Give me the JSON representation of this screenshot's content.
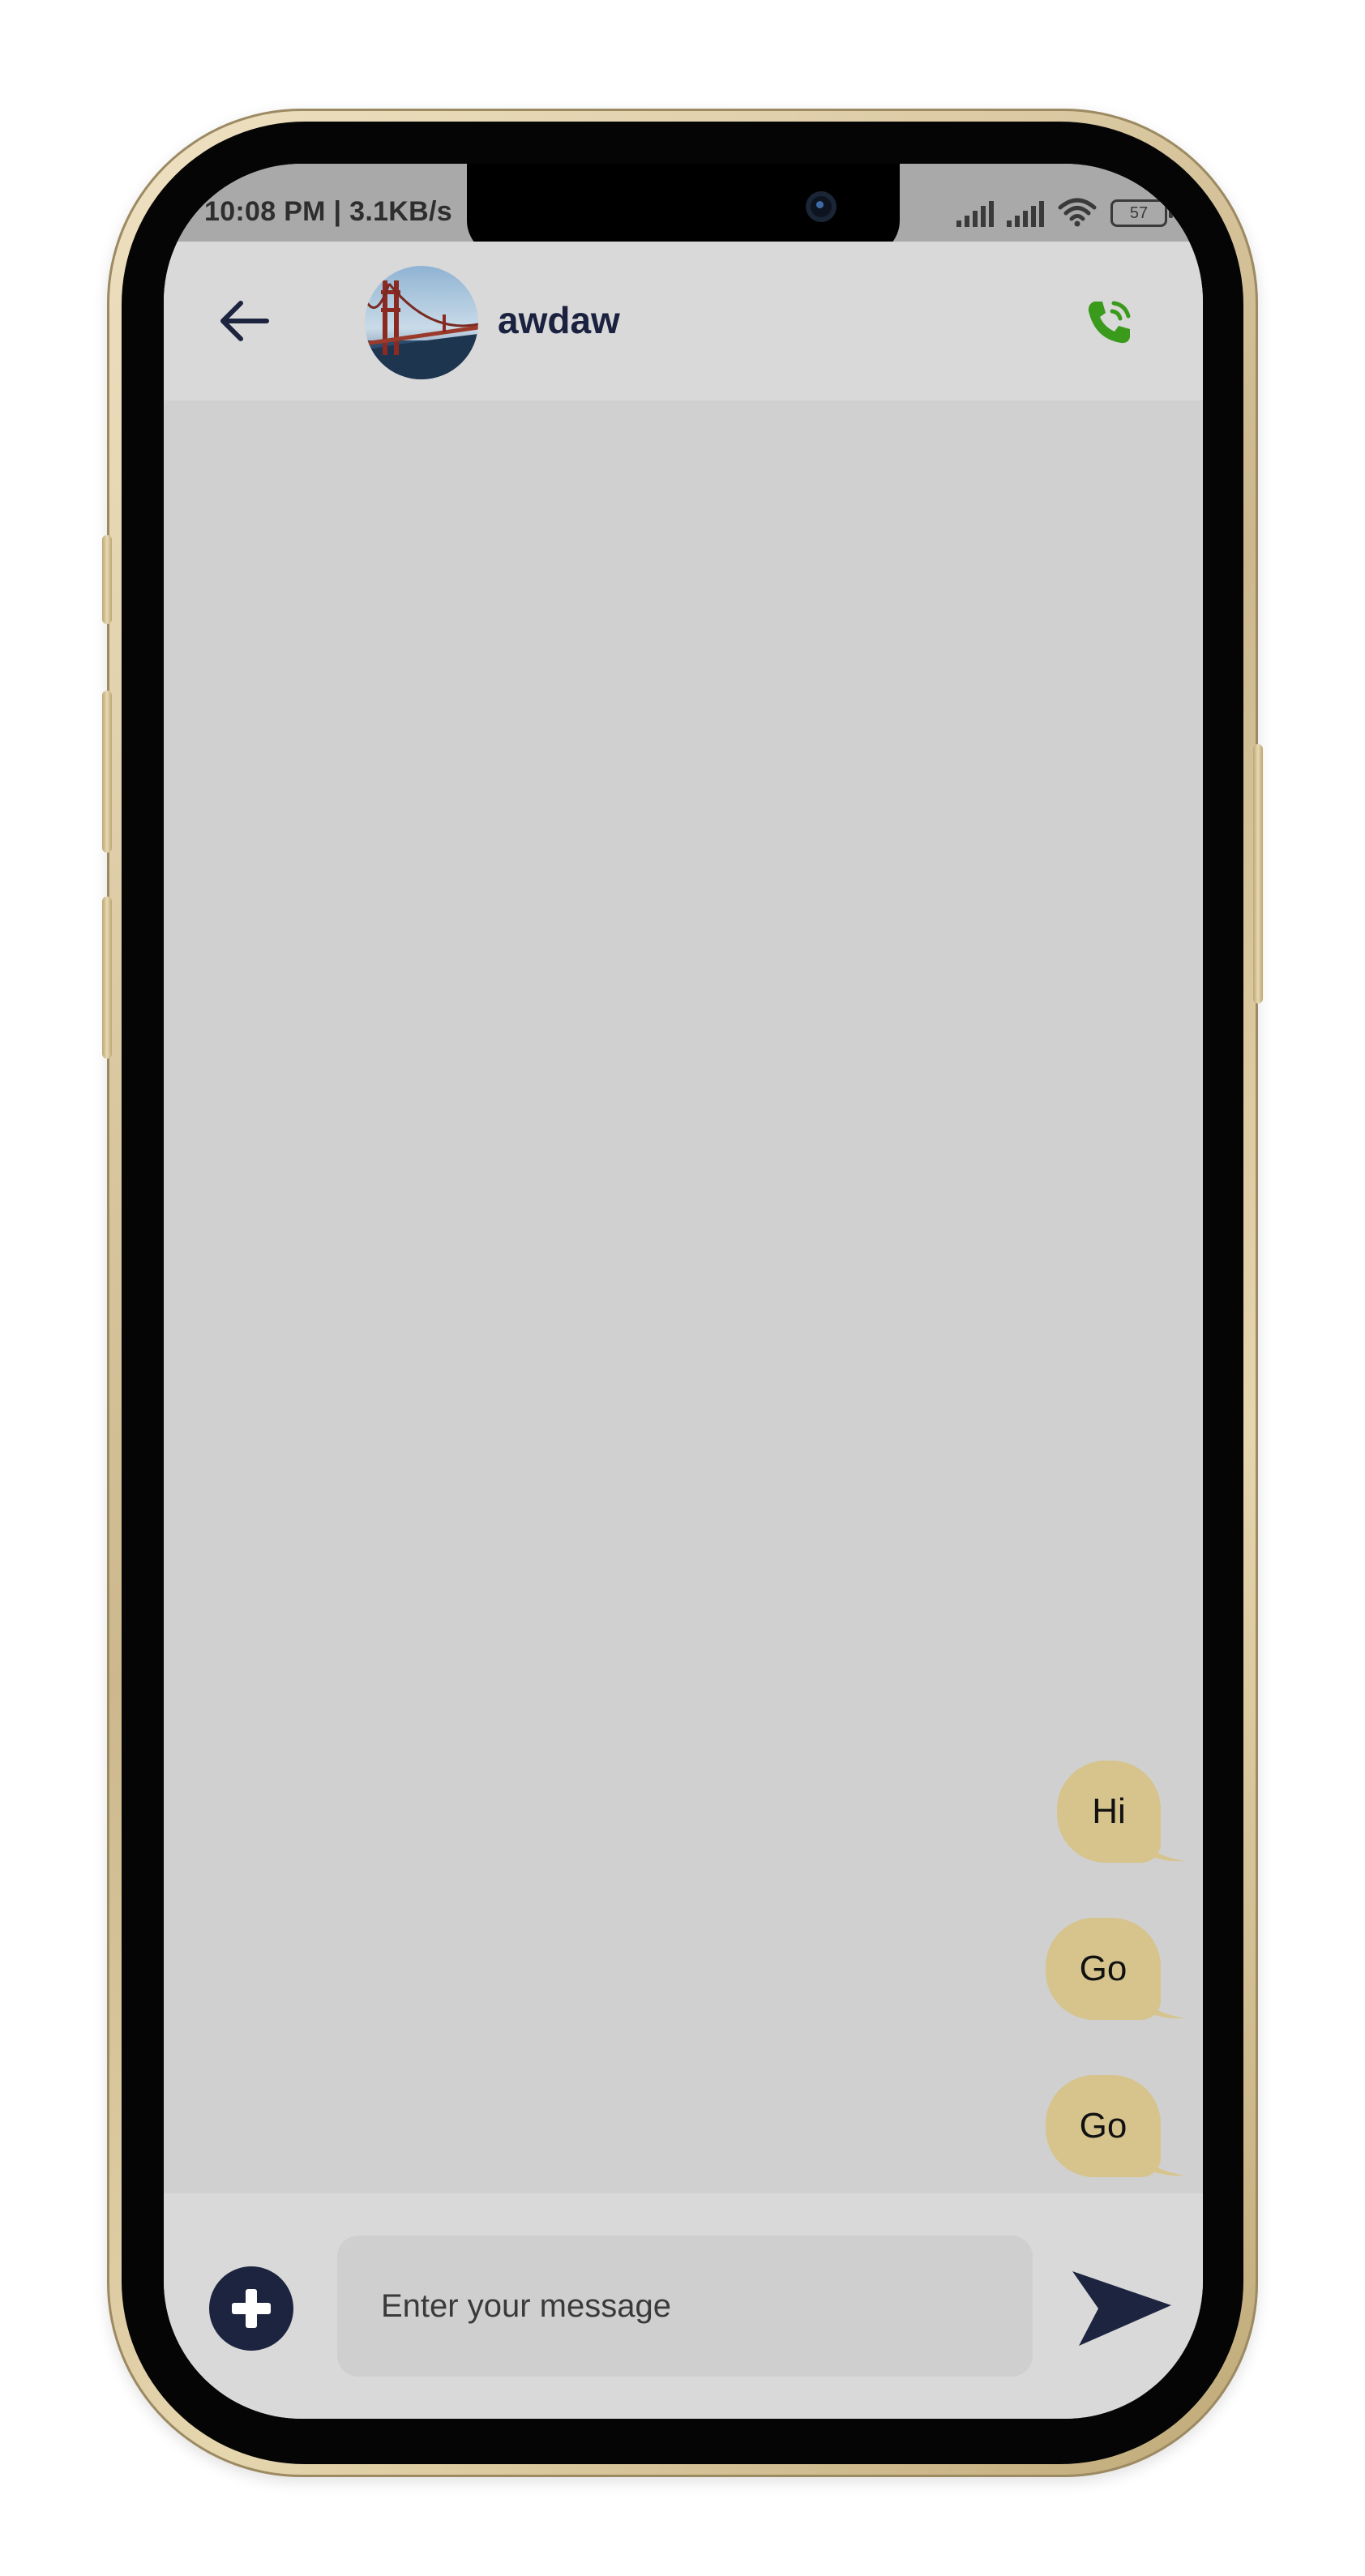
{
  "status_bar": {
    "time": "10:08 PM | 3.1KB/s",
    "battery_level": "57"
  },
  "header": {
    "back_icon": "arrow-left-icon",
    "avatar_icon": "golden-gate-bridge-photo",
    "contact_name": "awdaw",
    "call_icon": "phone-call-icon",
    "call_color": "#3a9a1c"
  },
  "messages": [
    {
      "text": "Hi",
      "direction": "outgoing"
    },
    {
      "text": "Go",
      "direction": "outgoing"
    },
    {
      "text": "Go",
      "direction": "outgoing"
    }
  ],
  "input_bar": {
    "add_icon": "plus-circle-icon",
    "placeholder": "Enter your message",
    "value": "",
    "send_icon": "send-arrow-icon"
  },
  "colors": {
    "accent_dark": "#1c2440",
    "bubble": "#d6c48c",
    "chat_background": "#d0d0d0",
    "header_background": "#d9d9d9"
  }
}
